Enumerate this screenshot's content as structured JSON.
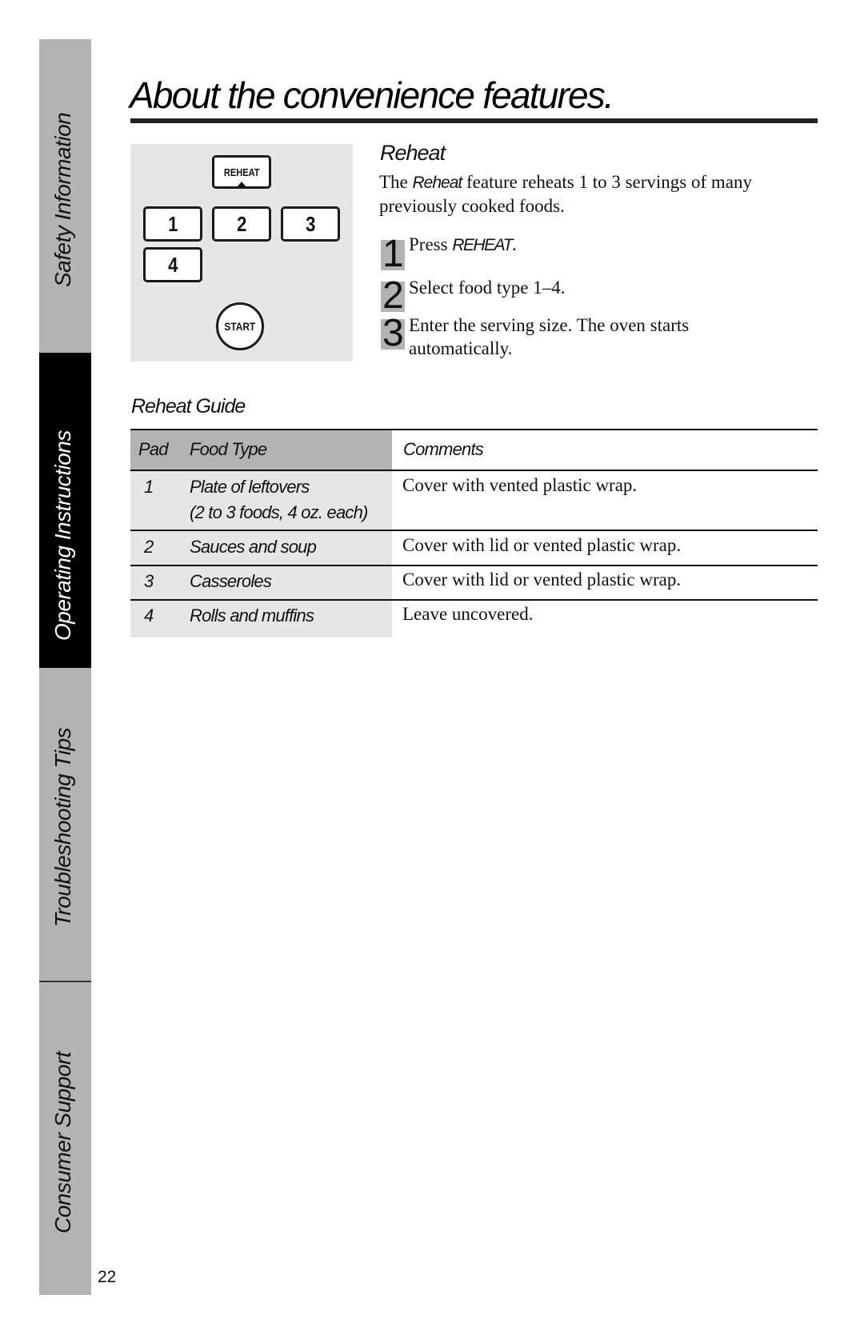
{
  "sidebar": {
    "sections": [
      {
        "label": "Safety Information",
        "active": false
      },
      {
        "label": "Operating Instructions",
        "active": true
      },
      {
        "label": "Troubleshooting Tips",
        "active": false
      },
      {
        "label": "Consumer Support",
        "active": false
      }
    ],
    "colors": {
      "inactive": "#b3b3b3",
      "active": "#000000"
    }
  },
  "page_number": "22",
  "header": {
    "title": "About the convenience features."
  },
  "keypad": {
    "reheat_label": "REHEAT",
    "number_keys": [
      "1",
      "2",
      "3",
      "4"
    ],
    "start_label": "START"
  },
  "reheat": {
    "heading": "Reheat",
    "intro_prefix": "The ",
    "intro_emph": "Reheat",
    "intro_suffix": " feature reheats 1 to 3 servings of many previously cooked foods.",
    "steps": [
      {
        "number": "1",
        "text_prefix": "Press ",
        "text_emph": "REHEAT",
        "text_suffix": "."
      },
      {
        "number": "2",
        "text_prefix": "Select food type 1–4.",
        "text_emph": "",
        "text_suffix": ""
      },
      {
        "number": "3",
        "text_line1": "Enter the serving size. The oven starts",
        "text_line2": "automatically."
      }
    ]
  },
  "guide": {
    "title": "Reheat Guide",
    "columns": {
      "pad": "Pad",
      "food_type": "Food Type",
      "comments": "Comments"
    },
    "rows": [
      {
        "pad": "1",
        "food_type": "Plate of leftovers",
        "food_note": "(2 to 3 foods, 4 oz. each)",
        "comments": "Cover with vented plastic wrap."
      },
      {
        "pad": "2",
        "food_type": "Sauces and soup",
        "food_note": "",
        "comments": "Cover with lid or vented plastic wrap."
      },
      {
        "pad": "3",
        "food_type": "Casseroles",
        "food_note": "",
        "comments": "Cover with lid or vented plastic wrap."
      },
      {
        "pad": "4",
        "food_type": "Rolls and muffins",
        "food_note": "",
        "comments": "Leave uncovered."
      }
    ]
  }
}
